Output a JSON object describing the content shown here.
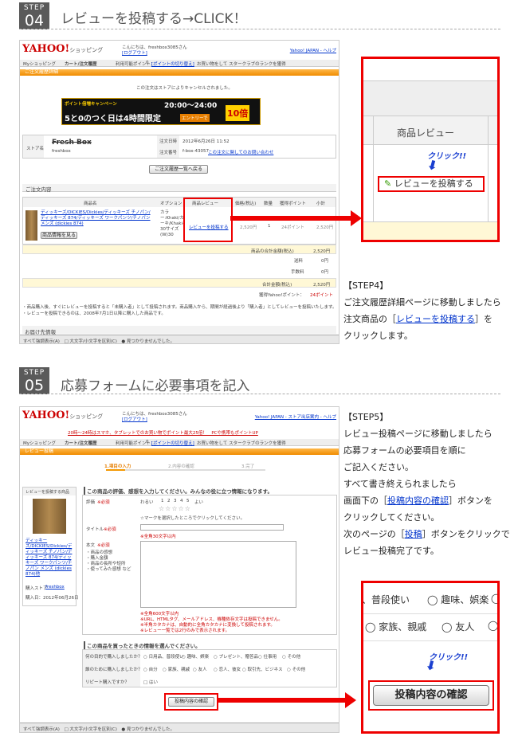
{
  "step4": {
    "label": "STEP",
    "num": "04",
    "title": "レビューを投稿する→CLICK！",
    "shot": {
      "header_greeting": "こんにちは、freshbox3085さん",
      "header_logout": "[ログアウト]",
      "header_links": "Yahoo! JAPAN ‐ ヘルプ",
      "nav": [
        "Myショッピング",
        "カート/注文履歴",
        "利用可能ポイント：",
        "0",
        "[ポイントの切り替え]",
        "お買い物をして スタークラブのランクを獲得"
      ],
      "section_title": "ご注文履歴詳細",
      "cancel_note": "この注文はストアによりキャンセルされました。",
      "banner": {
        "left": "ポイント倍増キャンペーン",
        "time": "20:00〜24:00",
        "main": "5と0のつく日は4時間限定",
        "entry": "エントリーで",
        "times": "10倍"
      },
      "store_label": "ストア名",
      "store_name": "Fresh Box",
      "store_sub": "freshbox",
      "order_date_label": "注文日時",
      "order_date": "2012年6月26日 11:52",
      "order_no_label": "注文番号",
      "order_no": "f-box-43057",
      "order_no_link": "この注文に関してのお問い合わせ",
      "back_button": "ご注文履歴一覧へ戻る",
      "contents_title": "ご注文内容",
      "col_headers": [
        "商品名",
        "オプション",
        "商品レビュー",
        "価格(税込)",
        "数量",
        "獲得ポイント",
        "小計"
      ],
      "item_name": "ディッキーズ/DICKIES/Dickies/ディッキーズ チノパン/ディッキーズ 874/ディッキーズ ワークパンツ/チノパン メンズ (dickies 874)",
      "item_info_button": "商品情報を見る",
      "item_option": "カラー:Khaki/カーキ/Khaki-30サイズ(W)30",
      "review_link": "レビューを投稿する",
      "price": "2,520円",
      "qty": "1",
      "points": "24ポイント",
      "subtotal": "2,520円",
      "total_label": "商品の合計金額(税込)",
      "total": "2,520円",
      "shipping_label": "送料",
      "shipping": "0円",
      "fee_label": "手数料",
      "fee": "0円",
      "grand_label": "合計金額(税込)",
      "grand": "2,520円",
      "point_label": "獲得Yahoo!ポイント：",
      "point_value": "24ポイント",
      "notes": [
        "・商品購入後、すぐにレビューを投稿すると「未購入者」として投稿されます。商品購入から、期間が経過後より「購入者」としてレビューを投稿いたします。",
        "・レビューを投稿できるのは、2008年7月1日以降に購入した商品です。"
      ],
      "delivery_title": "お届け先情報",
      "find_bar": "すべて強調表示(A)　□ 大文字/小文字を区別(C)　● 見つかりませんでした。"
    },
    "zoom": {
      "col_header": "商品レビュー",
      "click": "クリック!!",
      "button": "レビューを投稿する"
    },
    "desc": {
      "heading": "【STEP4】",
      "line1": "ご注文履歴詳細ページに移動しましたら",
      "line2a": "注文商品の［",
      "line2link": "レビューを投稿する",
      "line2b": "］を",
      "line3": "クリックします。"
    }
  },
  "step5": {
    "label": "STEP",
    "num": "05",
    "title": "応募フォームに必要事項を記入",
    "shot": {
      "header_greeting": "こんにちは、freshbox3085さん",
      "header_logout": "[ログアウト]",
      "header_links": "Yahoo! JAPAN ‐ ストア出店案内 ‐ ヘルプ",
      "promo": "20時〜24時はスマホ、タブレットでのお買い物でポイント最大25倍！　PCや携帯もポイントUP",
      "nav": [
        "Myショッピング",
        "カート/注文履歴",
        "利用可能ポイント：",
        "0",
        "[ポイントの切り替え]",
        "お買い物をして スタークラブのランクを獲得"
      ],
      "section_title": "レビュー投稿",
      "steps": [
        "1.項目の入力",
        "2.内容の確認",
        "3.完了"
      ],
      "left_box_title": "レビューを投稿する商品",
      "left_item": "ディッキーズ/DICKIES/Dickies/ディッキーズ チノパン/ディッキーズ 874/ディッキーズ ワークパンツ/チノパン メンズ (dickies 874)他",
      "buy_store_label": "購入ストア",
      "buy_store": "freshbox",
      "buy_date": "購入日：2012年06月26日",
      "q1_title": "この商品の評価、感想を入力してください。みんなの役に立つ情報になります。",
      "rating_label": "評価",
      "required": "※必須",
      "rating_scale": [
        "わるい",
        "1",
        "2",
        "3",
        "4",
        "5",
        "よい"
      ],
      "rating_note": "☆マークを選択したところでクリックしてください。",
      "title_label": "タイトル",
      "title_note": "※全角30文字以内",
      "body_label": "本文",
      "body_hints": [
        "・商品の感想",
        "・購入金額",
        "・商品の長所や短所",
        "・使ってみた感想 など"
      ],
      "body_notes": [
        "※全角600文字以内",
        "※URL、HTMLタグ、メールアドレス、機種依存文字は投稿できません。",
        "※半角カタカナは、自動的に全角カタカナに変換して投稿されます。",
        "※レビュー一覧では2行のみで表示されます。"
      ],
      "q2_title": "この商品を買ったときの情報を選んでください。",
      "purpose_label": "何の目的で購入しましたか？",
      "purpose_opts": [
        "日用品、普段使い",
        "趣味、娯楽",
        "プレゼント、贈答品",
        "仕事用",
        "その他"
      ],
      "for_label": "誰のために購入しましたか？",
      "for_opts": [
        "自分",
        "家族、親戚",
        "友人",
        "恋人、彼女",
        "取引先、ビジネス",
        "その他"
      ],
      "repeat_label": "リピート購入ですか？",
      "repeat_opt": "はい",
      "confirm_button": "投稿内容の確認",
      "find_bar": "すべて強調表示(A)　□ 大文字/小文字を区別(C)　● 見つかりませんでした。"
    },
    "zoom": {
      "row1": [
        "普段使い",
        "趣味、娯楽"
      ],
      "row2": [
        "家族、親戚",
        "友人"
      ],
      "click": "クリック!!",
      "button": "投稿内容の確認"
    },
    "desc": {
      "heading": "【STEP5】",
      "line1": "レビュー投稿ページに移動しましたら",
      "line2": "応募フォームの必要項目を順に",
      "line3": "ご記入ください。",
      "line4": "すべて書き終えられましたら",
      "line5a": "画面下の［",
      "line5link": "投稿内容の確認",
      "line5b": "］ボタンを",
      "line6": "クリックしてください。",
      "line7a": "次のページの［",
      "line7link": "投稿",
      "line7b": "］ボタンをクリックで",
      "line8": "レビュー投稿完了です。"
    }
  },
  "logo": {
    "text": "YAHOO!",
    "sub": "ショッピング",
    "japan": "JAPAN"
  },
  "colors": {
    "accent_red": "#e00000",
    "orange_bar": "#f39800",
    "link_blue": "#0033cc"
  }
}
